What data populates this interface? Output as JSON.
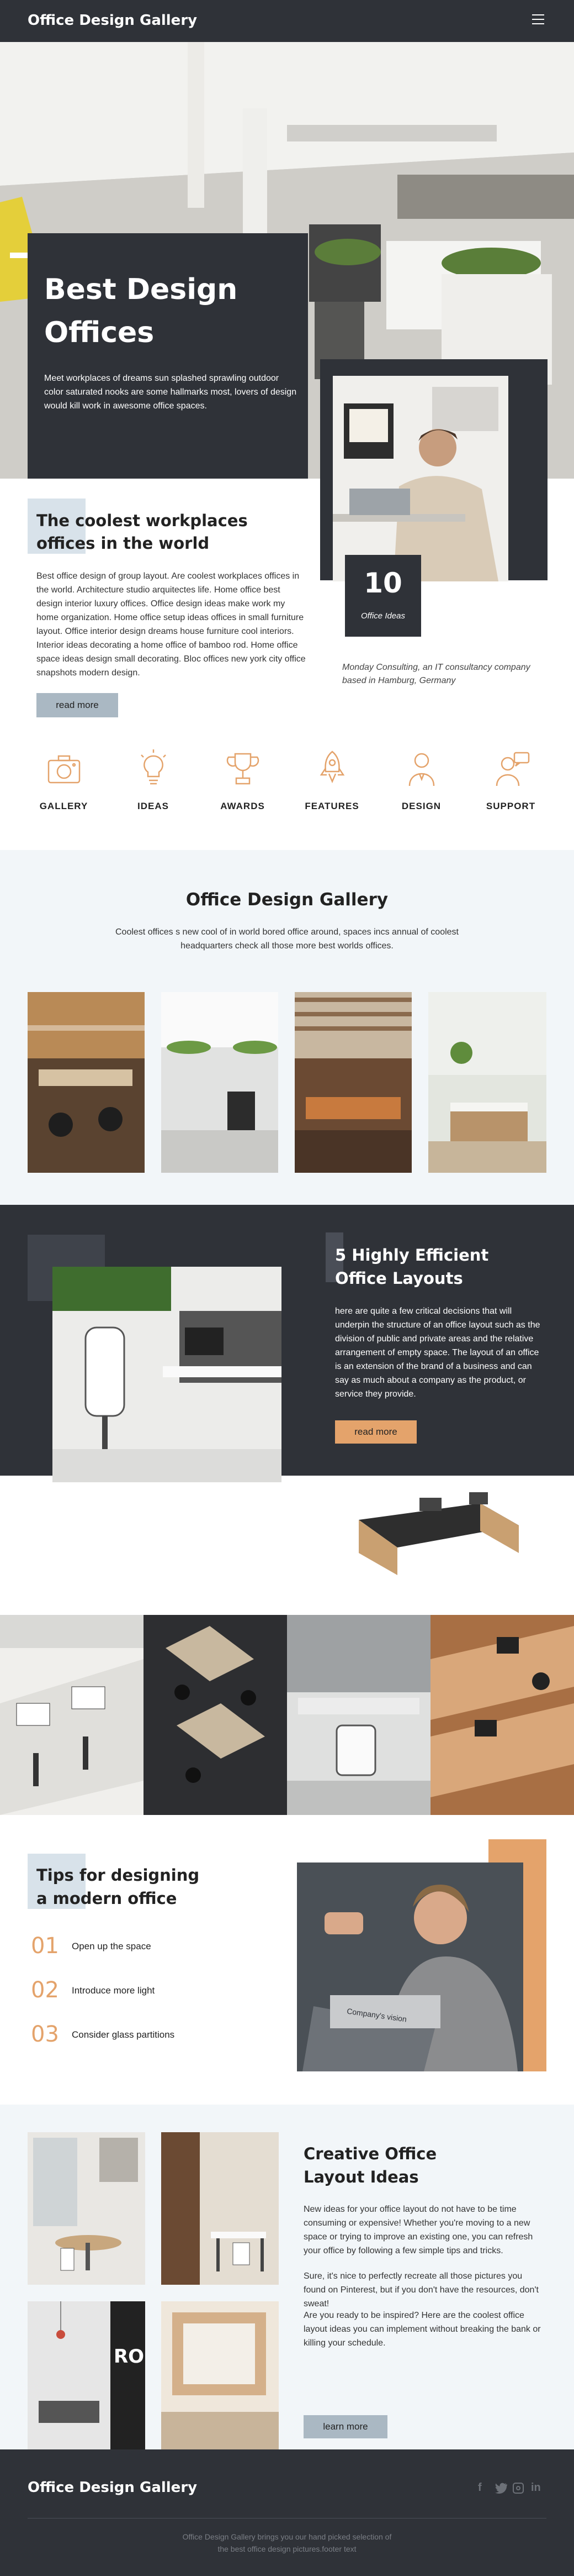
{
  "header": {
    "brand": "Office Design Gallery",
    "menu_icon": "hamburger-icon"
  },
  "hero": {
    "title_line1": "Best Design",
    "title_line2": "Offices",
    "text": "Meet workplaces of dreams sun splashed sprawling outdoor color saturated nooks are some hallmarks most, lovers of design would kill work in awesome office spaces."
  },
  "intro": {
    "heading_line1": "The coolest workplaces",
    "heading_line2": "offices in the world",
    "body": "Best office design of group layout. Are coolest workplaces offices in the world. Architecture studio arquitectes life. Home office best design interior luxury offices. Office design ideas make work my home organization. Home office setup ideas offices in small furniture layout. Office interior design dreams house furniture cool interiors. Interior ideas decorating a home office of bamboo rod. Home office space ideas design small decorating. Bloc offices new york city office snapshots modern design.",
    "button": "read more",
    "stat_number": "10",
    "stat_label": "Office Ideas",
    "caption": "Monday Consulting, an IT consultancy company based in Hamburg, Germany"
  },
  "features": [
    {
      "label": "GALLERY",
      "icon": "camera-icon"
    },
    {
      "label": "IDEAS",
      "icon": "lightbulb-icon"
    },
    {
      "label": "AWARDS",
      "icon": "trophy-icon"
    },
    {
      "label": "FEATURES",
      "icon": "rocket-icon"
    },
    {
      "label": "DESIGN",
      "icon": "designer-icon"
    },
    {
      "label": "SUPPORT",
      "icon": "support-icon"
    }
  ],
  "gallery": {
    "title": "Office Design Gallery",
    "subtitle": "Coolest offices s new cool of in world bored office around, spaces incs annual of coolest headquarters check all those more best worlds offices."
  },
  "layouts": {
    "heading_line1": "5 Highly Efficient",
    "heading_line2": "Office Layouts",
    "body": "here are quite a few critical decisions that will underpin the structure of an office layout such as the division of public and private areas and the relative arrangement of empty space. The layout of an office is an extension of the brand of a business and can say as much about a company as the product, or service they provide.",
    "button": "read more"
  },
  "tips": {
    "heading_line1": "Tips for designing",
    "heading_line2": "a modern office",
    "items": [
      {
        "num": "01",
        "text": "Open up the space"
      },
      {
        "num": "02",
        "text": "Introduce more light"
      },
      {
        "num": "03",
        "text": "Consider glass partitions"
      }
    ],
    "laptop_text": "Company's vision"
  },
  "creative": {
    "heading_line1": "Creative Office",
    "heading_line2": "Layout Ideas",
    "p1": "New ideas for your office layout do not have to be time consuming or expensive! Whether you're moving to a new space or trying to improve an existing one, you can refresh your office by following a few simple tips and tricks.",
    "p2": "Sure, it's nice to perfectly recreate all those pictures you found on Pinterest, but if you don't have the resources, don't sweat!",
    "p3": "Are you ready to be inspired? Here are the coolest office layout ideas you can implement without breaking the bank or killing your schedule.",
    "button": "learn more",
    "door_letters": "RO"
  },
  "footer": {
    "brand": "Office Design Gallery",
    "social": [
      "facebook-icon",
      "twitter-icon",
      "instagram-icon",
      "linkedin-icon"
    ],
    "line1": "Office Design Gallery brings you our hand picked selection of",
    "line2": "the best office design pictures.footer text"
  },
  "colors": {
    "dark": "#2f3238",
    "accent": "#e4a36b",
    "pale_blue": "#d8e2ea",
    "button_blue": "#aab8c3",
    "light_bg": "#f2f6f9"
  }
}
